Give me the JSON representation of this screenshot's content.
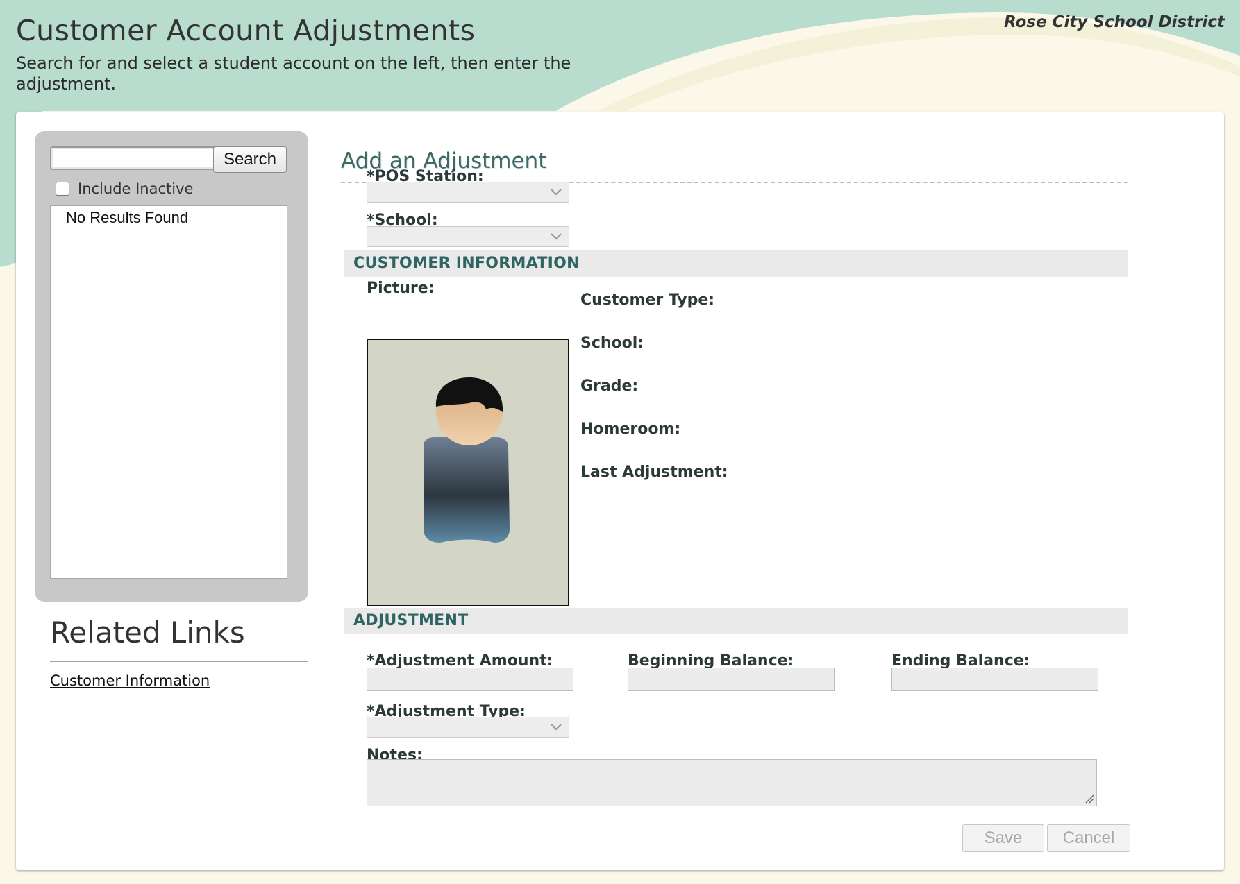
{
  "header": {
    "title": "Customer Account Adjustments",
    "subtitle": "Search for and select a student account on the left, then enter the adjustment.",
    "district": "Rose City School District"
  },
  "search": {
    "value": "",
    "button_label": "Search",
    "include_inactive_label": "Include Inactive",
    "include_inactive_checked": false,
    "no_results": "No Results Found"
  },
  "related": {
    "title": "Related Links",
    "links": [
      "Customer Information"
    ]
  },
  "form": {
    "title": "Add an Adjustment",
    "pos_station_label": "*POS Station:",
    "pos_station_value": "",
    "school_label": "*School:",
    "school_value": "",
    "customer_section": "CUSTOMER INFORMATION",
    "picture_label": "Picture:",
    "customer_type_label": "Customer Type:",
    "customer_school_label": "School:",
    "grade_label": "Grade:",
    "homeroom_label": "Homeroom:",
    "last_adjustment_label": "Last Adjustment:",
    "adjustment_section": "ADJUSTMENT",
    "adjustment_amount_label": "*Adjustment Amount:",
    "beginning_balance_label": "Beginning Balance:",
    "ending_balance_label": "Ending Balance:",
    "adjustment_type_label": "*Adjustment Type:",
    "notes_label": "Notes:",
    "save_label": "Save",
    "cancel_label": "Cancel"
  },
  "colors": {
    "header_band": "#b8dccd",
    "background": "#fbf8ea",
    "section_text": "#2e6461",
    "form_title": "#3a6a66"
  },
  "icons": [
    "chevron-down-icon",
    "person-placeholder-icon",
    "resize-grip-icon",
    "checkbox-icon"
  ]
}
